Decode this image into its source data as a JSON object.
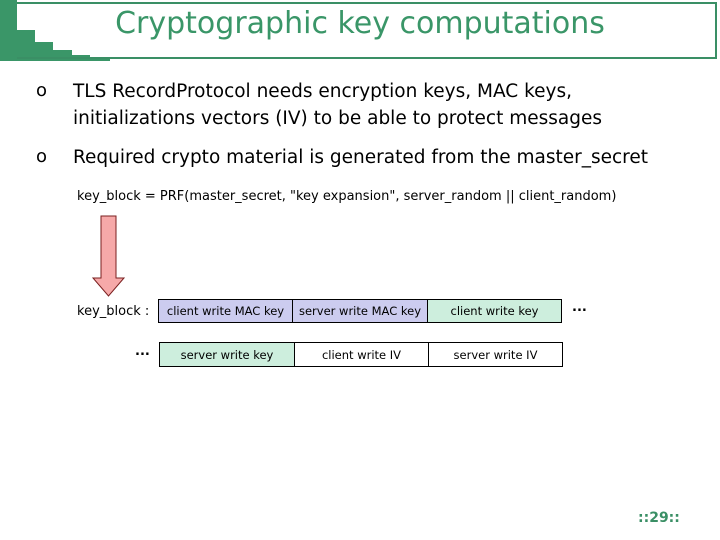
{
  "slide": {
    "title": "Cryptographic key computations",
    "accent_color": "#3a9668",
    "bullets": [
      {
        "marker": "o",
        "lines": [
          "TLS RecordProtocol needs encryption keys, MAC keys,",
          "initializations vectors (IV) to be able to protect messages"
        ]
      },
      {
        "marker": "o",
        "lines": [
          "Required crypto material is generated from the master_secret"
        ]
      }
    ],
    "formula": "key_block = PRF(master_secret, \"key expansion\", server_random || client_random)",
    "diagram": {
      "arrow_icon": "down-arrow-icon",
      "row1_label": "key_block :",
      "row2_label": "...",
      "row1_cells": [
        "client write MAC key",
        "server write MAC key",
        "client write key"
      ],
      "row1_trailing": "...",
      "row2_cells": [
        "server write key",
        "client write IV",
        "server write IV"
      ],
      "colors": {
        "mac": "#ccccef",
        "key": "#cdeedd",
        "iv": "#ffffff"
      }
    },
    "page_number": "::29::"
  }
}
